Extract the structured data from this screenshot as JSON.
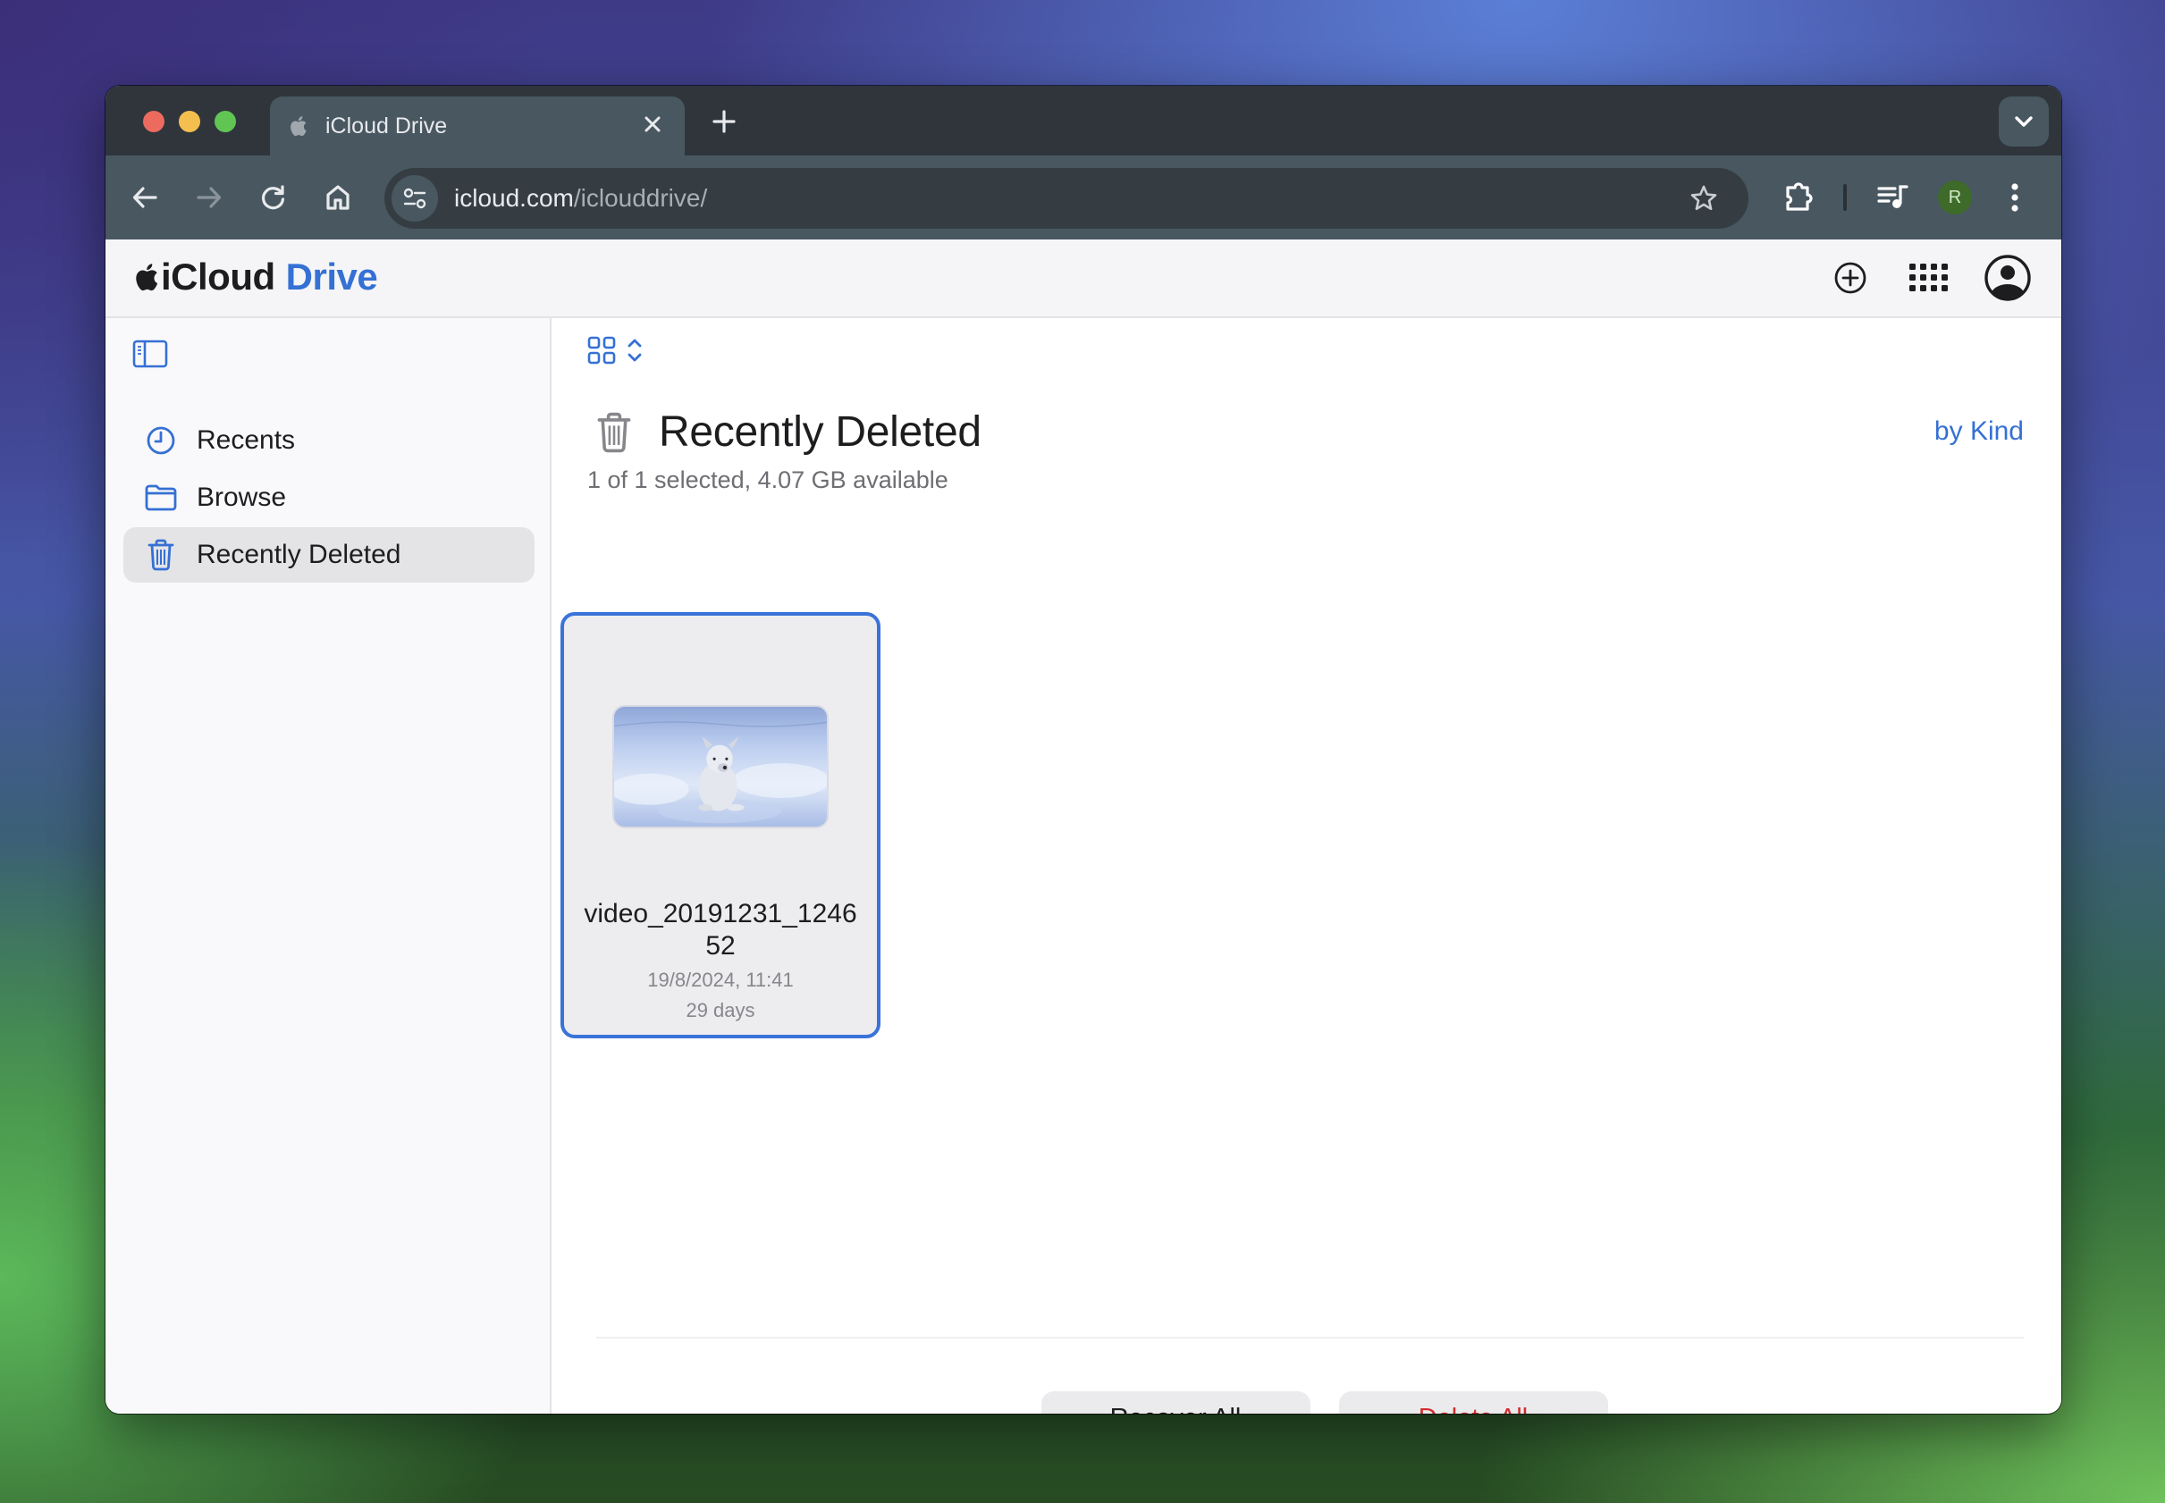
{
  "browser": {
    "tab": {
      "title": "iCloud Drive",
      "favicon": "apple-logo-icon",
      "close_icon": "close-icon"
    },
    "new_tab_icon": "plus-icon",
    "tab_search_icon": "chevron-down-icon",
    "nav": {
      "back_icon": "arrow-left-icon",
      "forward_icon": "arrow-right-icon",
      "reload_icon": "reload-icon",
      "home_icon": "home-icon"
    },
    "address_bar": {
      "site_info_icon": "tune-icon",
      "url_domain": "icloud.com",
      "url_path": "/iclouddrive/",
      "bookmark_icon": "star-icon"
    },
    "toolbar_right": {
      "extensions_icon": "puzzle-icon",
      "media_icon": "queue-music-icon",
      "profile_initial": "R",
      "menu_icon": "more-vertical-icon"
    },
    "colors": {
      "tab_strip": "#2f353b",
      "toolbar": "#485760",
      "profile_bg": "#3e6b2a"
    }
  },
  "app": {
    "brand": {
      "logo_icon": "apple-logo-icon",
      "name_part1": "iCloud",
      "name_part2": "Drive"
    },
    "header_actions": {
      "create_icon": "plus-circle-icon",
      "apps_icon": "apps-grid-icon",
      "account_icon": "person-circle-icon"
    },
    "colors": {
      "accent": "#3570d4",
      "destructive": "#d12d2d",
      "selection_border": "#3a73d9"
    }
  },
  "sidebar": {
    "toggle_icon": "sidebar-icon",
    "items": [
      {
        "label": "Recents",
        "icon": "clock-icon",
        "selected": false
      },
      {
        "label": "Browse",
        "icon": "folder-icon",
        "selected": false
      },
      {
        "label": "Recently Deleted",
        "icon": "trash-icon",
        "selected": true
      }
    ]
  },
  "main": {
    "view_toggle_icon": "grid-view-icon",
    "view_toggle_chevron": "chevron-up-down-icon",
    "title_icon": "trash-icon",
    "title": "Recently Deleted",
    "subtitle": "1 of 1 selected, 4.07 GB available",
    "sort_label": "by Kind",
    "files": [
      {
        "name": "video_20191231_124652",
        "name_line1": "video_20191231_1246",
        "name_line2": "52",
        "date": "19/8/2024, 11:41",
        "days_remaining": "29 days",
        "thumbnail": "white dog lying in snow",
        "selected": true
      }
    ],
    "footer": {
      "recover_label": "Recover All",
      "delete_label": "Delete All"
    }
  }
}
